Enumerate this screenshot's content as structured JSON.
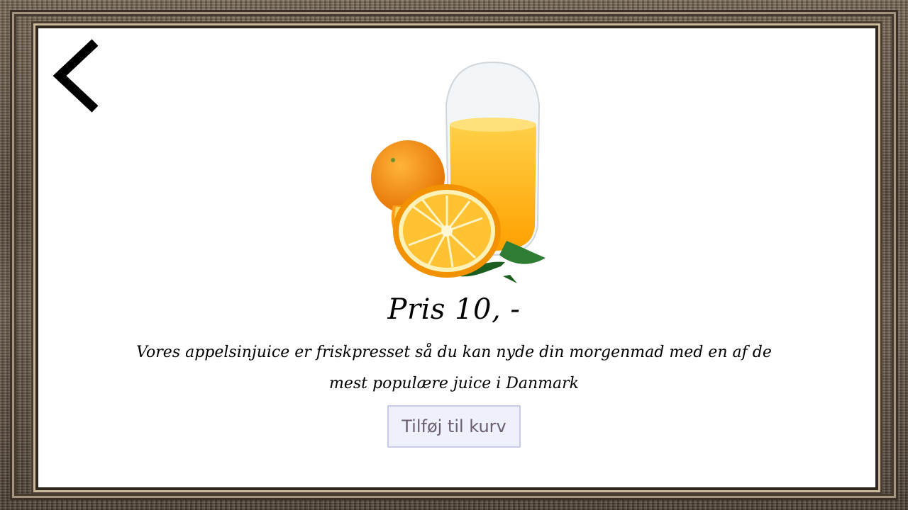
{
  "product": {
    "price": "Pris 10, -",
    "description": "Vores appelsinjuice er friskpresset så du kan nyde din morgenmad med en af de mest populære juice i Danmark"
  },
  "actions": {
    "add_to_cart": "Tilføj til kurv",
    "back": "back-chevron-icon"
  },
  "colors": {
    "frame": "#6e5f4f",
    "canvas": "#ffffff",
    "button_bg": "#eef0fb",
    "button_text": "#6b5f6e"
  }
}
